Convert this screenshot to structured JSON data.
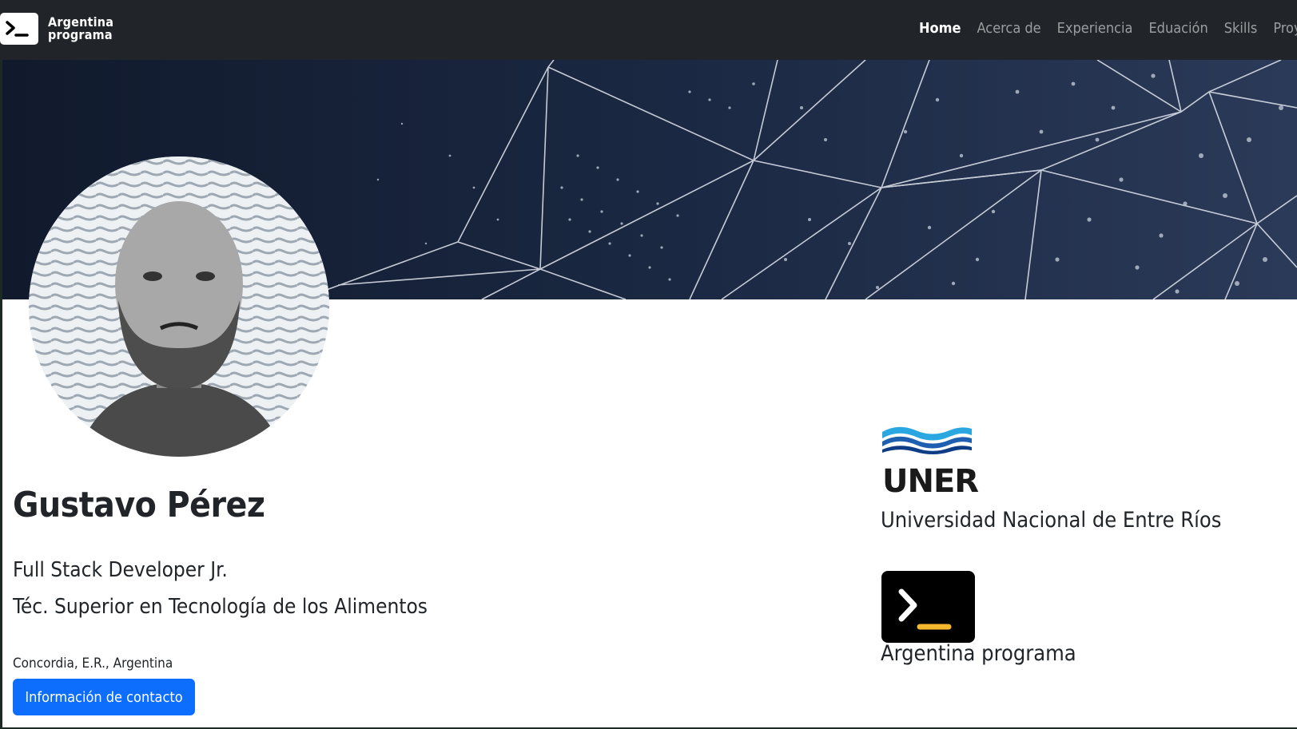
{
  "brand": {
    "line1": "Argentina",
    "line2": "programa",
    "icon": "terminal-prompt-icon"
  },
  "nav": {
    "items": [
      {
        "label": "Home",
        "active": true
      },
      {
        "label": "Acerca de",
        "active": false
      },
      {
        "label": "Experiencia",
        "active": false
      },
      {
        "label": "Eduación",
        "active": false
      },
      {
        "label": "Skills",
        "active": false
      },
      {
        "label": "Proy",
        "active": false
      }
    ]
  },
  "profile": {
    "name": "Gustavo Pérez",
    "titles": [
      "Full Stack Developer Jr.",
      "Téc. Superior en Tecnología de los Alimentos"
    ],
    "location": "Concordia, E.R., Argentina",
    "contact_button": "Información de contacto"
  },
  "affiliations": [
    {
      "logo_text": "UNER",
      "name": "Universidad Nacional de Entre Ríos",
      "icon": "uner-waves-logo"
    },
    {
      "name": "Argentina programa",
      "icon": "terminal-prompt-icon"
    }
  ],
  "colors": {
    "navbar": "#212529",
    "primary_button": "#0d6efd",
    "banner": "#1b2944",
    "uner_blue": "#1e88e5",
    "ap_underscore": "#f5b82e"
  }
}
